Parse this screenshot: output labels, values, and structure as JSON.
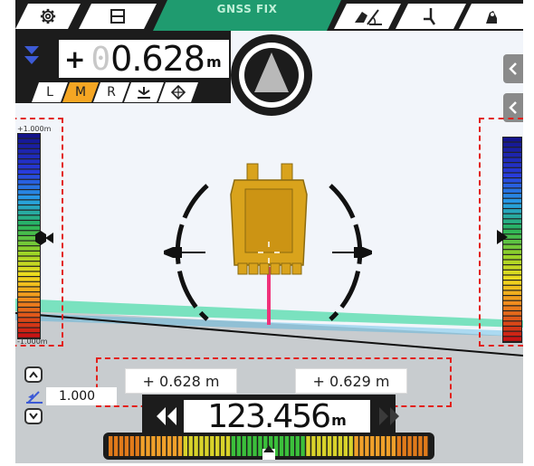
{
  "header": {
    "status": "GNSS FIX"
  },
  "tabs": [
    {
      "icon": "gear-icon"
    },
    {
      "icon": "split-view-icon"
    },
    {
      "icon": "gnss-status"
    },
    {
      "icon": "bucket-tilt-icon"
    },
    {
      "icon": "bucket-swing-icon"
    },
    {
      "icon": "excavator-icon"
    }
  ],
  "elevation": {
    "sign": "+",
    "ghost_digit": "0",
    "value": "0.628",
    "unit": "m"
  },
  "reference_buttons": [
    "L",
    "M",
    "R"
  ],
  "selected_reference": "M",
  "scale": {
    "top_label": "+1.000m",
    "bottom_label": "-1.000m",
    "indicator_position": 0.5
  },
  "offsets": {
    "left": "+ 0.628 m",
    "right": "+ 0.629 m"
  },
  "small_control": {
    "value": "1.000"
  },
  "main_readout": {
    "value": "123.456",
    "unit": "m"
  },
  "level_bar": {
    "indicator_position": 0.5
  },
  "colors": {
    "accent_orange": "#f5a623",
    "gnss_green": "#1f9b6f",
    "bucket_gold": "#d9a31c",
    "dashed_red": "#e2211c",
    "target_line": "#f0327a",
    "design_surface": "#6de0b8"
  }
}
